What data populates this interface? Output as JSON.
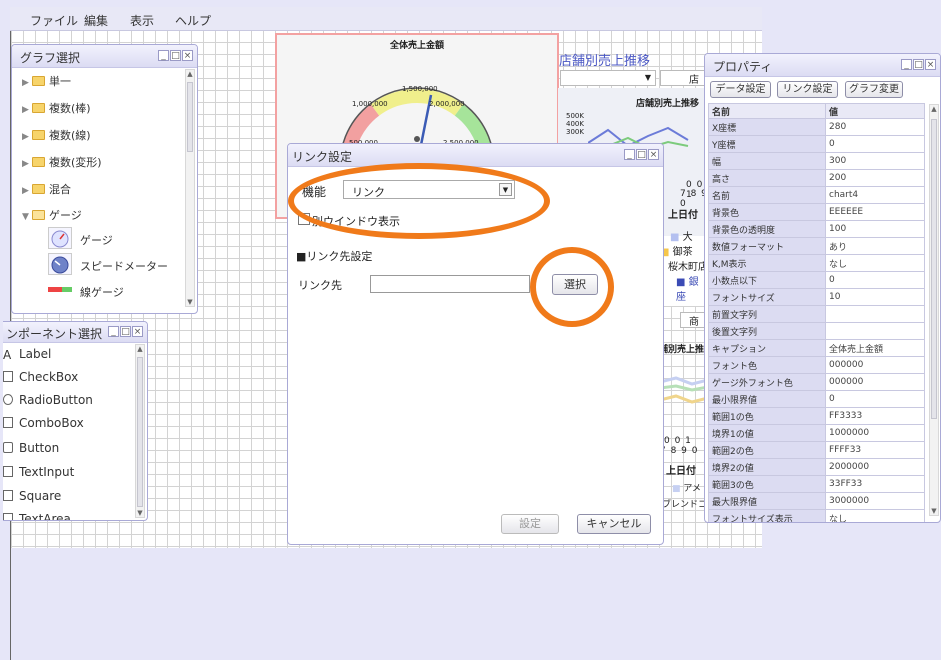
{
  "menu": {
    "items": [
      "ファイル",
      "編集",
      "表示",
      "ヘルプ"
    ]
  },
  "graph_select": {
    "title": "グラフ選択",
    "items": [
      {
        "label": "単一",
        "expanded": false
      },
      {
        "label": "複数(棒)",
        "expanded": false
      },
      {
        "label": "複数(線)",
        "expanded": false
      },
      {
        "label": "複数(変形)",
        "expanded": false
      },
      {
        "label": "混合",
        "expanded": false
      },
      {
        "label": "ゲージ",
        "expanded": true
      }
    ],
    "sub_items": [
      "ゲージ",
      "スピードメーター",
      "線ゲージ"
    ]
  },
  "component_select": {
    "title": "ンポーネント選択",
    "items": [
      "Label",
      "CheckBox",
      "RadioButton",
      "ComboBox",
      "Button",
      "TextInput",
      "Square",
      "TextArea"
    ],
    "icons": [
      "label-icon",
      "checkbox-icon",
      "radio-icon",
      "combobox-icon",
      "button-icon",
      "textinput-icon",
      "square-icon",
      "textarea-icon"
    ]
  },
  "gauge": {
    "title": "全体売上金額",
    "ticks": [
      "1,500,000",
      "1,000,000",
      "2,000,000",
      "500,000",
      "2,500,000"
    ]
  },
  "background_charts": {
    "title": "店舗別売上推移",
    "combo_value": "",
    "combo_button": "店舗",
    "inner_title": "店舗別売上推移",
    "y_ticks": [
      "500K",
      "400K",
      "300K"
    ],
    "digits_1": [
      "0 0 1",
      "7 8 9 0"
    ],
    "date_label_1": "上日付",
    "legend_1": [
      "大",
      "御茶",
      "桜木町店",
      "K,M表示",
      "■ 銀座"
    ],
    "tab_label": "商",
    "lower_title": "店舗別売上推移",
    "digits_2": [
      "0 0 1",
      "7 8 9 0"
    ],
    "date_label_2": "上日付",
    "legend_2": [
      "アメ",
      "ブレンドコー"
    ]
  },
  "dialog": {
    "title": "リンク設定",
    "function_label": "機能",
    "function_value": "リンク",
    "new_window_label": "別ウインドウ表示",
    "new_window_checked": false,
    "section_label": "■リンク先設定",
    "link_label": "リンク先",
    "link_value": "",
    "select_button": "選択",
    "ok_button": "設定",
    "cancel_button": "キャンセル"
  },
  "properties": {
    "title": "プロパティ",
    "buttons": [
      "データ設定",
      "リンク設定",
      "グラフ変更"
    ],
    "col_name": "名前",
    "col_value": "値",
    "rows": [
      [
        "X座標",
        "280"
      ],
      [
        "Y座標",
        "0"
      ],
      [
        "幅",
        "300"
      ],
      [
        "高さ",
        "200"
      ],
      [
        "名前",
        "chart4"
      ],
      [
        "背景色",
        "EEEEEE"
      ],
      [
        "背景色の透明度",
        "100"
      ],
      [
        "数値フォーマット",
        "あり"
      ],
      [
        "K,M表示",
        "なし"
      ],
      [
        "小数点以下",
        "0"
      ],
      [
        "フォントサイズ",
        "10"
      ],
      [
        "前置文字列",
        ""
      ],
      [
        "後置文字列",
        ""
      ],
      [
        "キャプション",
        "全体売上金額"
      ],
      [
        "フォント色",
        "000000"
      ],
      [
        "ゲージ外フォント色",
        "000000"
      ],
      [
        "最小限界値",
        "0"
      ],
      [
        "範囲1の色",
        "FF3333"
      ],
      [
        "境界1の値",
        "1000000"
      ],
      [
        "範囲2の色",
        "FFFF33"
      ],
      [
        "境界2の値",
        "2000000"
      ],
      [
        "範囲3の色",
        "33FF33"
      ],
      [
        "最大限界値",
        "3000000"
      ],
      [
        "フォントサイズ表示",
        "なし"
      ]
    ]
  },
  "colors": {
    "accent": "#f07a1a",
    "panel_border": "#a9a9d6",
    "frame": "#e6e6f8"
  }
}
